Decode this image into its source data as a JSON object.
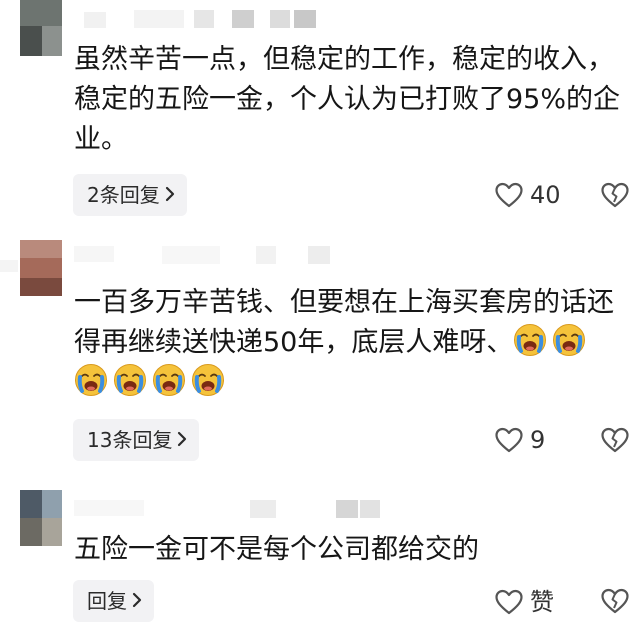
{
  "comments": [
    {
      "text": "虽然辛苦一点，但稳定的工作，稳定的收入，稳定的五险一金，个人认为已打败了95%的企业。",
      "reply_label": "2条回复",
      "likes": "40"
    },
    {
      "text": "一百多万辛苦钱、但要想在上海买套房的话还得再继续送快递50年，底层人难呀、",
      "emoji_count": 6,
      "emoji_name": "loudly-crying-face",
      "reply_label": "13条回复",
      "likes": "9"
    },
    {
      "text": "五险一金可不是每个公司都给交的",
      "reply_label": "回复",
      "likes": "赞"
    }
  ],
  "icons": {
    "like": "heart-outline-icon",
    "dislike": "broken-heart-icon",
    "reply_chevron": "chevron-right-icon"
  },
  "colors": {
    "reply_bg": "#f2f2f4",
    "text": "#161616",
    "icon": "#555555",
    "emoji_face": "#f5c33b",
    "emoji_tears": "#3b8ee0"
  }
}
